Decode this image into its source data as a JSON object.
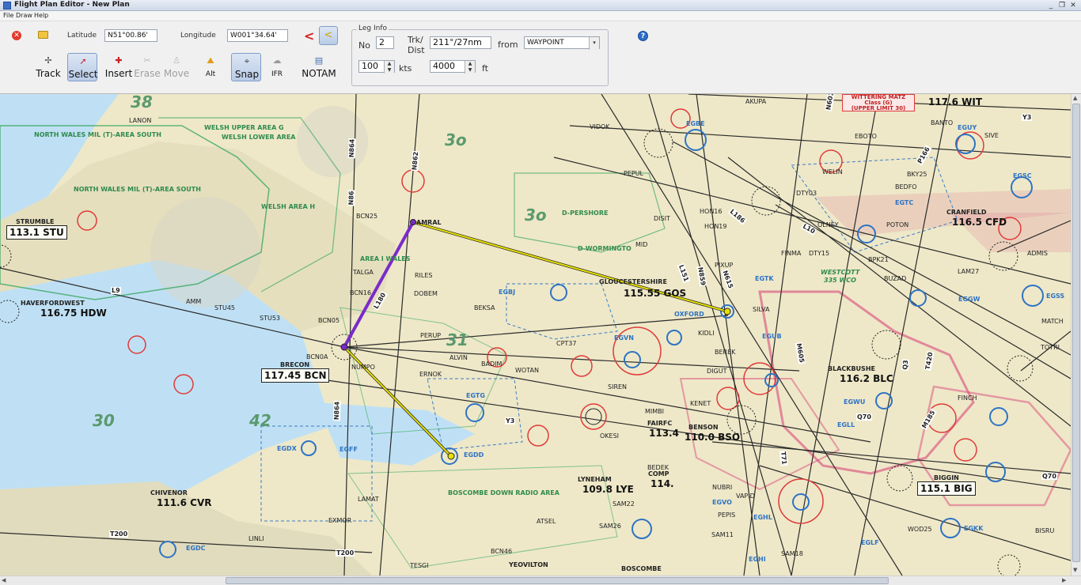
{
  "window": {
    "title": "Flight Plan Editor - New Plan",
    "min": "_",
    "max": "❐",
    "close": "✕"
  },
  "menu": [
    "File",
    "Draw",
    "Help"
  ],
  "coords": {
    "lat_label": "Latitude",
    "lat_value": "N51°00.86'",
    "lon_label": "Longitude",
    "lon_value": "W001°34.64'"
  },
  "tools": {
    "track": "Track",
    "select": "Select",
    "insert": "Insert",
    "erase": "Erase",
    "move": "Move",
    "alt": "Alt",
    "snap": "Snap",
    "ifr": "IFR",
    "notam": "NOTAM"
  },
  "leg_info": {
    "group_label": "Leg Info",
    "no_label": "No",
    "no_value": "2",
    "trk_label": "Trk/",
    "dist_label": "Dist",
    "trk_value": "211°/27nm",
    "from_label": "from",
    "from_value": "WAYPOINT",
    "speed_value": "100",
    "speed_unit": "kts",
    "alt_value": "4000",
    "alt_unit": "ft"
  },
  "map": {
    "nav_boxes": {
      "stu": "113.1 STU",
      "hdw": "116.75 HDW",
      "bcn": "117.45 BCN",
      "gos": "115.55 GOS",
      "lye": "109.8 LYE",
      "bso": "110.0 BSO",
      "cvr": "111.6 CVR",
      "blc": "116.2 BLC",
      "big": "115.1 BIG",
      "cfd": "116.5 CFD",
      "wit": "117.6 WIT",
      "comp": "114.",
      "fairfc": "113.4"
    },
    "names": {
      "strumble": "STRUMBLE",
      "haverfordwest": "HAVERFORDWEST",
      "brecon": "BRECON",
      "gloucestershire": "GLOUCESTERSHIRE",
      "lyneham": "LYNEHAM",
      "benson": "BENSON",
      "chivenor": "CHIVENOR",
      "blackbushe": "BLACKBUSHE",
      "biggin": "BIGGIN",
      "cranfield": "CRANFIELD",
      "yeovilton": "YEOVILTON",
      "boscombe": "BOSCOMBE",
      "fairfc": "FAIRFC",
      "comp": "COMP"
    },
    "labels": [
      "NORTH WALES MIL (T)-AREA SOUTH",
      "NORTH WALES MIL (T)-AREA SOUTH",
      "WELSH UPPER AREA G",
      "WELSH LOWER AREA",
      "WELSH AREA H",
      "D-PERSHORE",
      "D-WORMINGTO",
      "AREA I WALES",
      "BOSCOMBE DOWN RADIO AREA",
      "WESTCOTT",
      "335 WCO",
      "LANON",
      "AMRAL",
      "TALGA",
      "RILES",
      "DOBEM",
      "BEKSA",
      "PERUP",
      "ALVIN",
      "ERNOK",
      "WOTAN",
      "BADIM",
      "SIREN",
      "OKESI",
      "MIMBI",
      "KENET",
      "NUBRI",
      "VAPID",
      "PEPIS",
      "SAM26",
      "SAM22",
      "ATSEL",
      "LINLI",
      "EXMOR",
      "LAMAT",
      "TESGI",
      "BCN46",
      "OXFORD",
      "KIDLI",
      "DIGUT",
      "BEREK",
      "SILVA",
      "FINMA",
      "OLNEY",
      "POTON",
      "BUZAD",
      "WELIN",
      "BEDFO",
      "EBOTO",
      "BANTO",
      "SIVE",
      "AKUPA",
      "VIDOK",
      "PEPUL",
      "DISIT",
      "HON16",
      "HON19",
      "PIXUP",
      "MID",
      "ADMIS",
      "LAM27",
      "MATCH",
      "TOTRI",
      "FINCH",
      "WOD25",
      "SAM18",
      "SAM11",
      "BISRU",
      "CPT37",
      "STU45",
      "STU53",
      "AMM",
      "BCN05",
      "BCN0A",
      "NUMPO",
      "BCN25",
      "BCN16",
      "BEDEK",
      "DTY03",
      "DTY15",
      "BPK21",
      "BKY25"
    ],
    "airspace_codes": [
      "EGBJ",
      "EGBE",
      "EGTC",
      "EGSC",
      "EGUY",
      "EGTK",
      "EGUB",
      "EGVN",
      "EGTG",
      "EGDD",
      "EGFF",
      "EGDX",
      "EGDC",
      "EGVO",
      "EGHL",
      "EGHI",
      "EGLF",
      "EGKK",
      "EGWU",
      "EGLL",
      "EGSS",
      "EGGW"
    ],
    "airways": [
      "L9",
      "L180",
      "N864",
      "N862",
      "N86",
      "Y3",
      "T200",
      "L151",
      "N859",
      "N615",
      "L10",
      "L186",
      "Q70",
      "Q3",
      "M605",
      "T420",
      "P166",
      "M185",
      "T71",
      "N601"
    ],
    "big_numbers": [
      "38",
      "3o",
      "3o",
      "31",
      "42",
      "30",
      "3o"
    ],
    "warning_box": {
      "line1": "WITTERING MATZ",
      "line2": "Class (G)",
      "line3": "(UPPER LIMIT 30)"
    }
  },
  "colors": {
    "route_yellow": "#e8e000",
    "route_purple": "#7a2bc8",
    "airway": "#2a2a2a",
    "controlled_airspace": "#d9487a",
    "matz": "#e03a3a",
    "mil_area": "#3aa860",
    "water": "#bfe0f4",
    "terrain": "#e9e4c2"
  }
}
